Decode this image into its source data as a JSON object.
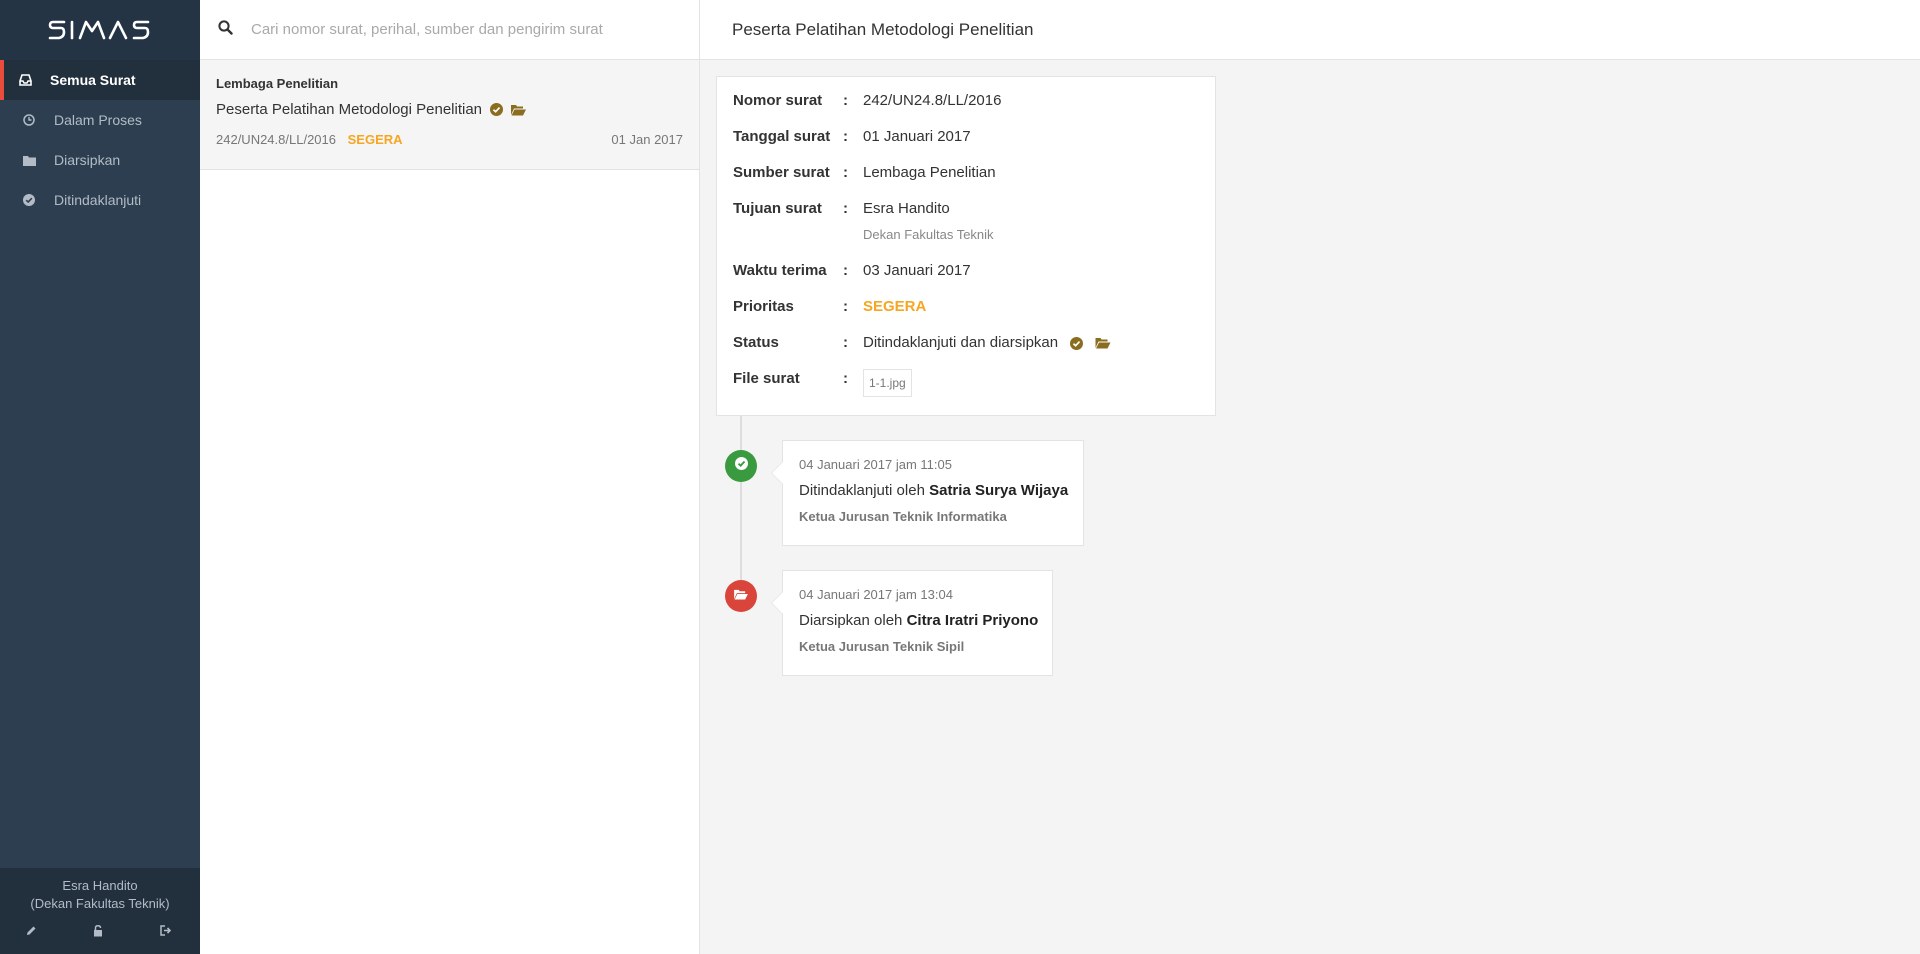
{
  "app": {
    "logo_text": "SIMAS"
  },
  "sidebar": {
    "items": [
      {
        "label": "Semua Surat",
        "icon": "inbox-icon",
        "active": true
      },
      {
        "label": "Dalam Proses",
        "icon": "clock-icon",
        "active": false
      },
      {
        "label": "Diarsipkan",
        "icon": "folder-icon",
        "active": false
      },
      {
        "label": "Ditindaklanjuti",
        "icon": "check-circle-icon",
        "active": false
      }
    ],
    "user": {
      "name": "Esra Handito",
      "role": "(Dekan Fakultas Teknik)"
    },
    "footer_icons": [
      "pencil-icon",
      "unlock-icon",
      "sign-out-icon"
    ]
  },
  "search": {
    "placeholder": "Cari nomor surat, perihal, sumber dan pengirim surat",
    "value": ""
  },
  "mail_list": [
    {
      "sender": "Lembaga Penelitian",
      "subject": "Peserta Pelatihan Metodologi Penelitian",
      "number": "242/UN24.8/LL/2016",
      "priority": "SEGERA",
      "date": "01 Jan 2017"
    }
  ],
  "detail": {
    "title": "Peserta Pelatihan Metodologi Penelitian",
    "fields": {
      "nomor": {
        "label": "Nomor surat",
        "value": "242/UN24.8/LL/2016"
      },
      "tanggal": {
        "label": "Tanggal surat",
        "value": "01 Januari 2017"
      },
      "sumber": {
        "label": "Sumber surat",
        "value": "Lembaga Penelitian"
      },
      "tujuan": {
        "label": "Tujuan surat",
        "value": "Esra Handito",
        "sub": "Dekan Fakultas Teknik"
      },
      "waktu": {
        "label": "Waktu terima",
        "value": "03 Januari 2017"
      },
      "prioritas": {
        "label": "Prioritas",
        "value": "SEGERA"
      },
      "status": {
        "label": "Status",
        "value": "Ditindaklanjuti dan diarsipkan"
      },
      "file": {
        "label": "File surat",
        "value": "1-1.jpg"
      }
    },
    "colon": ":"
  },
  "timeline": [
    {
      "time": "04 Januari 2017 jam 11:05",
      "action": "Ditindaklanjuti oleh",
      "actor": "Satria Surya Wijaya",
      "role": "Ketua Jurusan Teknik Informatika",
      "icon": "check-circle-icon",
      "color": "#3a9a3f"
    },
    {
      "time": "04 Januari 2017 jam 13:04",
      "action": "Diarsipkan oleh",
      "actor": "Citra Iratri Priyono",
      "role": "Ketua Jurusan Teknik Sipil",
      "icon": "folder-open-icon",
      "color": "#d9453b"
    }
  ],
  "colors": {
    "accent": "#e74c3c",
    "priority": "#f5a623",
    "sidebar": "#2c3e50",
    "status_icon": "#8a6d1f"
  }
}
